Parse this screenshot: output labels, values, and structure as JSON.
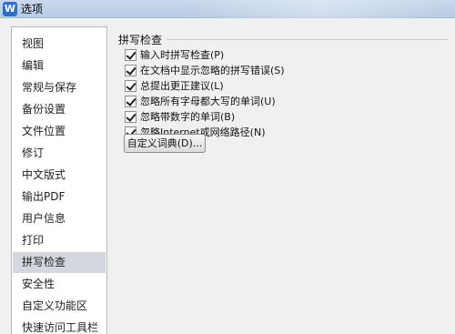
{
  "window": {
    "title": "选项",
    "app_icon_letter": "W"
  },
  "sidebar": {
    "selected_index": 11,
    "items": [
      {
        "label": "视图"
      },
      {
        "label": "编辑"
      },
      {
        "label": "常规与保存"
      },
      {
        "label": "备份设置"
      },
      {
        "label": "文件位置"
      },
      {
        "label": "修订"
      },
      {
        "label": "中文版式"
      },
      {
        "label": "输出PDF"
      },
      {
        "label": "用户信息"
      },
      {
        "label": "打印"
      },
      {
        "label": "拼写检查"
      },
      {
        "label": "安全性"
      },
      {
        "label": "自定义功能区"
      },
      {
        "label": "快速访问工具栏"
      }
    ]
  },
  "spell_check": {
    "group_title": "拼写检查",
    "options": [
      {
        "label": "输入时拼写检查(P)",
        "checked": true
      },
      {
        "label": "在文档中显示忽略的拼写错误(S)",
        "checked": true
      },
      {
        "label": "总提出更正建议(L)",
        "checked": true
      },
      {
        "label": "忽略所有字母都大写的单词(U)",
        "checked": true
      },
      {
        "label": "忽略带数字的单词(B)",
        "checked": true
      },
      {
        "label": "忽略Internet或网络路径(N)",
        "checked": true
      }
    ],
    "custom_dictionary_button": "自定义词典(D)..."
  }
}
